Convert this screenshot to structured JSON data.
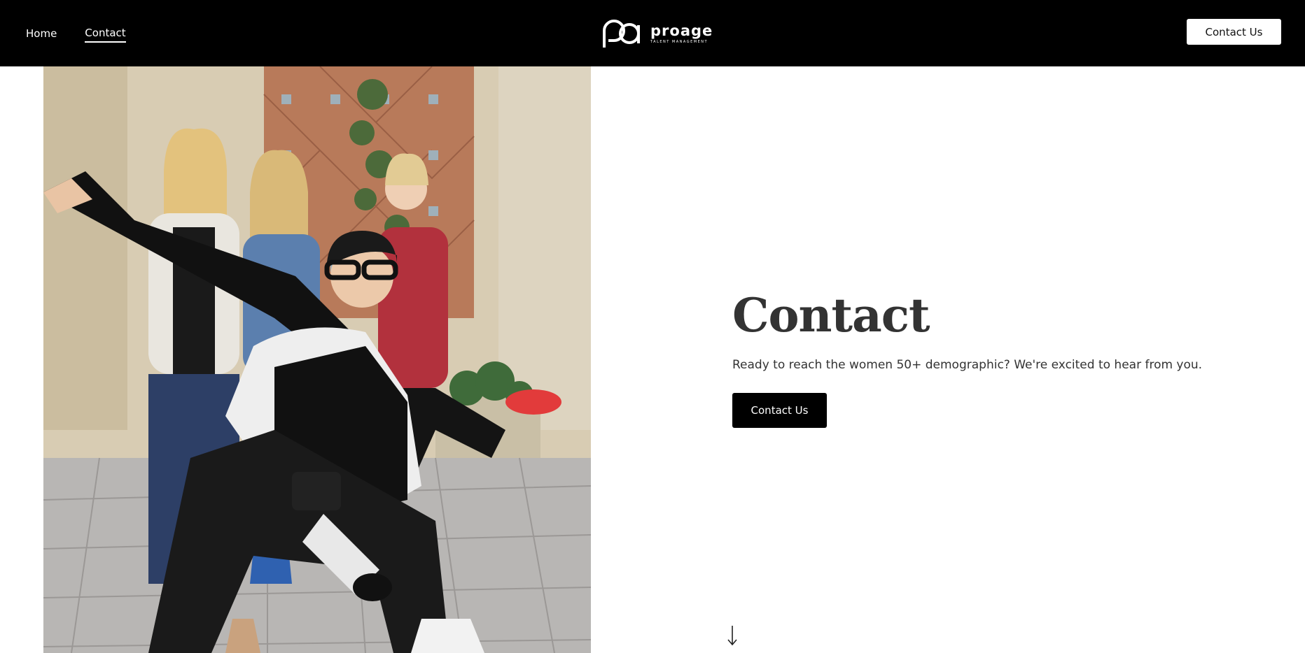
{
  "header": {
    "nav": [
      {
        "label": "Home",
        "active": false
      },
      {
        "label": "Contact",
        "active": true
      }
    ],
    "logo": {
      "word": "proage",
      "subtitle": "TALENT MANAGEMENT",
      "icon": "pa-monogram"
    },
    "cta_label": "Contact Us"
  },
  "hero": {
    "image": "group-photo-women-posing",
    "title": "Contact",
    "lead": "Ready to reach the women 50+ demographic? We're excited to hear from you.",
    "cta_label": "Contact Us",
    "scroll_icon": "arrow-down-icon"
  },
  "colors": {
    "header_bg": "#000000",
    "text": "#333333",
    "button_dark": "#000000"
  }
}
